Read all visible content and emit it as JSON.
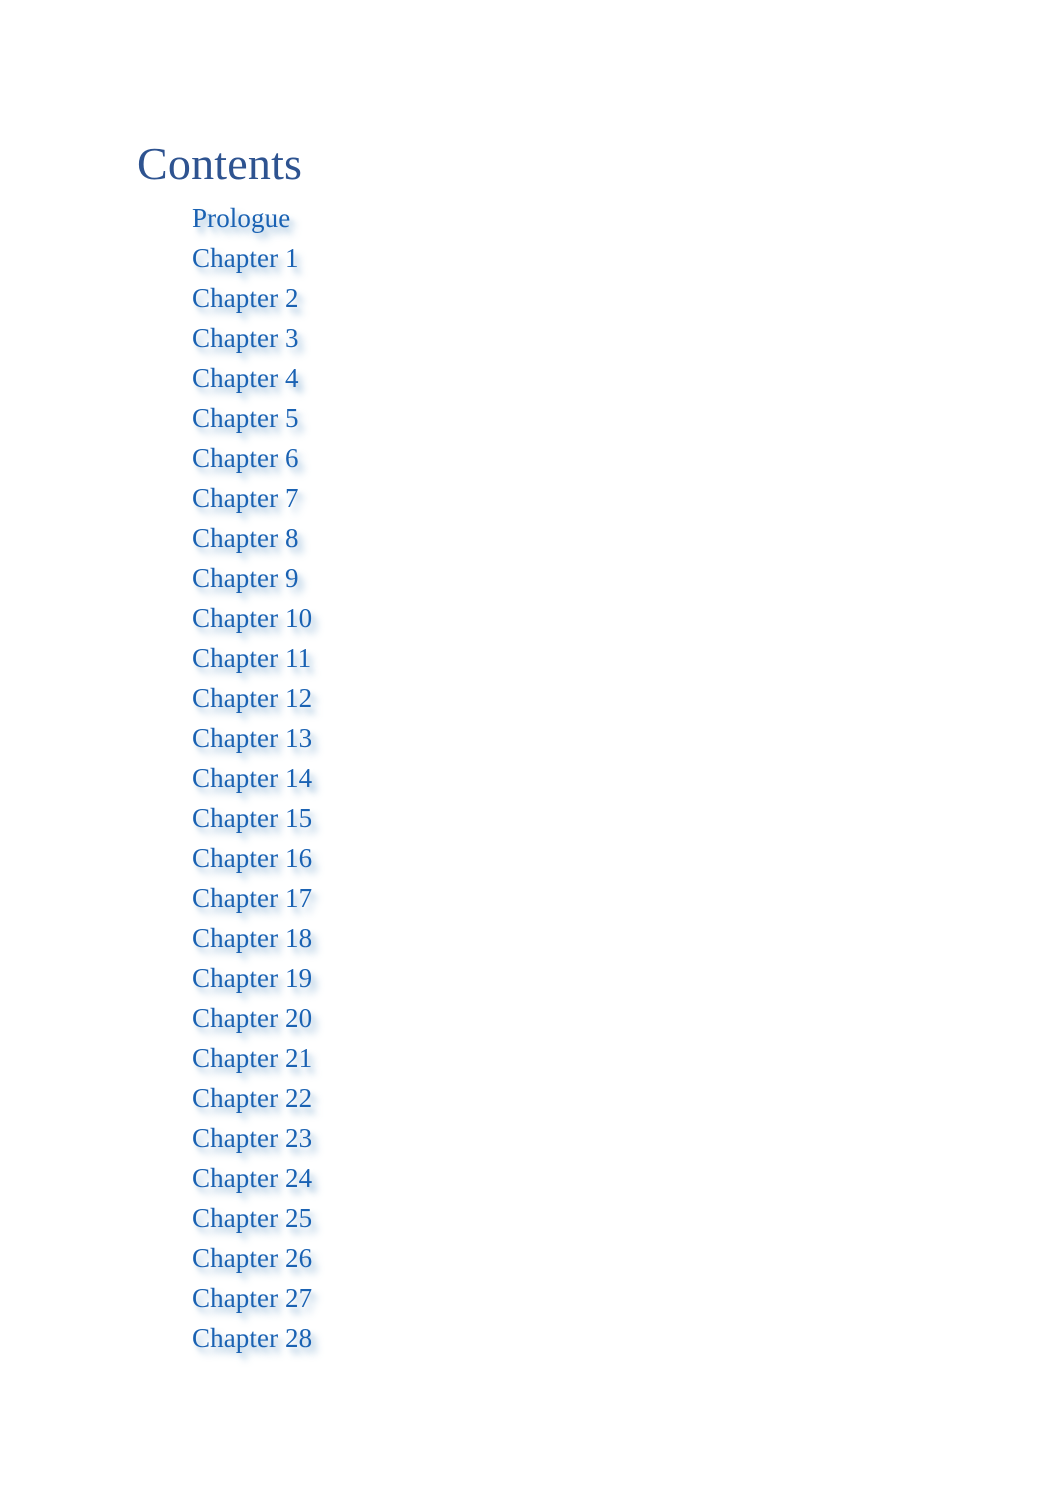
{
  "document": {
    "background_color": "#ffffff",
    "heading_color": "#2e5390",
    "link_color": "#1a62b3",
    "link_shadow_color": "#96bad8"
  },
  "contents": {
    "heading": "Contents",
    "entries": [
      {
        "label": "Prologue"
      },
      {
        "label": "Chapter 1"
      },
      {
        "label": "Chapter 2"
      },
      {
        "label": "Chapter 3"
      },
      {
        "label": "Chapter 4"
      },
      {
        "label": "Chapter 5"
      },
      {
        "label": "Chapter 6"
      },
      {
        "label": "Chapter 7"
      },
      {
        "label": "Chapter 8"
      },
      {
        "label": "Chapter 9"
      },
      {
        "label": "Chapter 10"
      },
      {
        "label": "Chapter 11"
      },
      {
        "label": "Chapter 12"
      },
      {
        "label": "Chapter 13"
      },
      {
        "label": "Chapter 14"
      },
      {
        "label": "Chapter 15"
      },
      {
        "label": "Chapter 16"
      },
      {
        "label": "Chapter 17"
      },
      {
        "label": "Chapter 18"
      },
      {
        "label": "Chapter 19"
      },
      {
        "label": "Chapter 20"
      },
      {
        "label": "Chapter 21"
      },
      {
        "label": "Chapter 22"
      },
      {
        "label": "Chapter 23"
      },
      {
        "label": "Chapter 24"
      },
      {
        "label": "Chapter 25"
      },
      {
        "label": "Chapter 26"
      },
      {
        "label": "Chapter 27"
      },
      {
        "label": "Chapter 28"
      }
    ]
  }
}
